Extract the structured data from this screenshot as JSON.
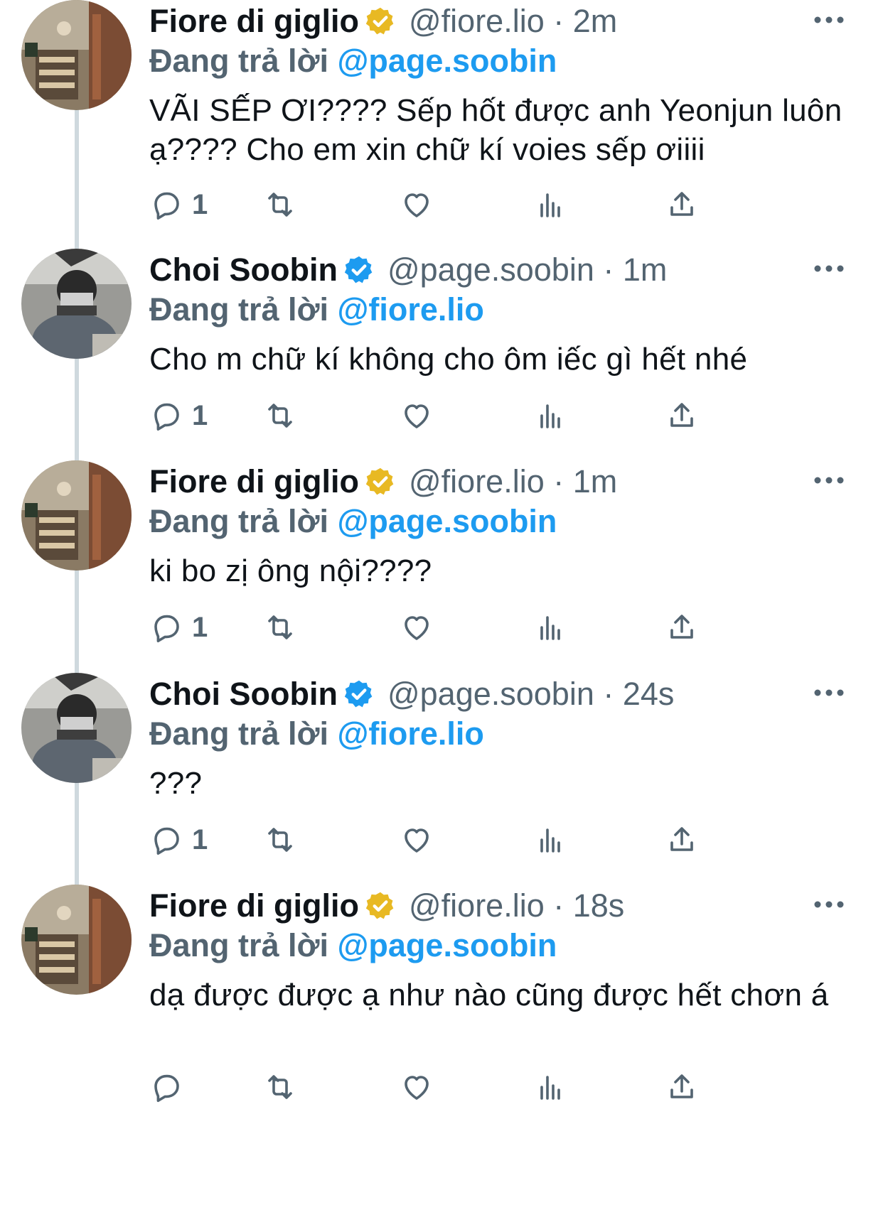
{
  "colors": {
    "accent": "#1d9bf0",
    "muted": "#536471",
    "text": "#0f1419",
    "gold_badge": "#e8b923",
    "blue_badge": "#1d9bf0",
    "thread_line": "#cfd9de"
  },
  "icons": {
    "reply": "speech-bubble-icon",
    "retweet": "retweet-icon",
    "like": "heart-icon",
    "views": "bar-chart-icon",
    "share": "share-icon",
    "more": "more-dots-icon"
  },
  "tweets": [
    {
      "name": "Fiore di giglio",
      "badge": "gold",
      "handle": "@fiore.lio",
      "time": "2m",
      "reply_prefix": "Đang trả lời",
      "reply_to": "@page.soobin",
      "text": "VÃI SẾP ƠI???? Sếp hốt được anh Yeonjun luôn ạ???? Cho em xin chữ kí voies sếp ơiiii",
      "reply_count": "1"
    },
    {
      "name": "Choi Soobin",
      "badge": "blue",
      "handle": "@page.soobin",
      "time": "1m",
      "reply_prefix": "Đang trả lời",
      "reply_to": "@fiore.lio",
      "text": "Cho m chữ kí không cho ôm iếc gì hết nhé",
      "reply_count": "1"
    },
    {
      "name": "Fiore di giglio",
      "badge": "gold",
      "handle": "@fiore.lio",
      "time": "1m",
      "reply_prefix": "Đang trả lời",
      "reply_to": "@page.soobin",
      "text": "ki bo zị ông nội????",
      "reply_count": "1"
    },
    {
      "name": "Choi Soobin",
      "badge": "blue",
      "handle": "@page.soobin",
      "time": "24s",
      "reply_prefix": "Đang trả lời",
      "reply_to": "@fiore.lio",
      "text": "???",
      "reply_count": "1"
    },
    {
      "name": "Fiore di giglio",
      "badge": "gold",
      "handle": "@fiore.lio",
      "time": "18s",
      "reply_prefix": "Đang trả lời",
      "reply_to": "@page.soobin",
      "text": "dạ được được ạ như nào cũng được hết chơn á",
      "reply_count": ""
    }
  ]
}
